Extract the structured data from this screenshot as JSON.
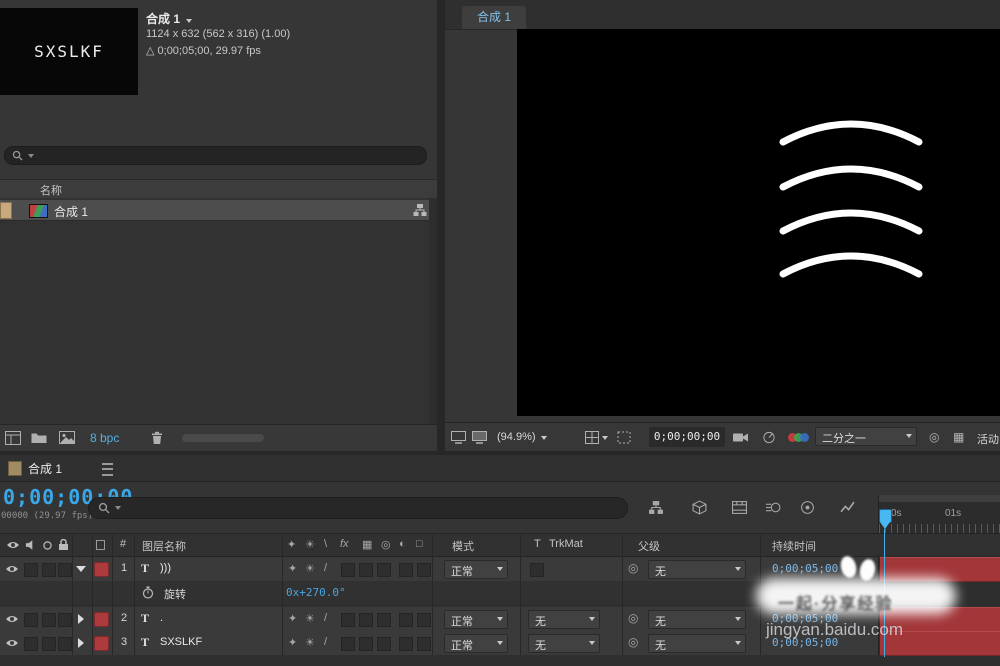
{
  "project": {
    "thumb_text": "SXSLKF",
    "comp_title": "合成 1",
    "info_size": "1124 x 632 (562 x 316) (1.00)",
    "info_duration": "△ 0;00;05;00, 29.97 fps",
    "name_column": "名称",
    "item_label": "合成 1",
    "bpc_label": "8 bpc"
  },
  "viewer": {
    "tab_label": "合成 1",
    "zoom_value": "(94.9%)",
    "timecode": "0;00;00;00",
    "resolution_value": "二分之一",
    "camera_label": "活动"
  },
  "timeline": {
    "tab_label": "合成 1",
    "timecode": "0;00;00;00",
    "frame_info": "00000 (29.97 fps)",
    "ruler_t0": "0s",
    "ruler_t1": "01s",
    "columns": {
      "num": "#",
      "name": "图层名称",
      "mode": "模式",
      "trkmat_t": "T",
      "trkmat": "TrkMat",
      "parent": "父级",
      "duration": "持续时间"
    },
    "switch_glyphs": {
      "shy": "✦",
      "sun": "☀",
      "bslash": "\\",
      "fx": "fx",
      "blur": "▦",
      "pick": "◎",
      "half": "◐",
      "cube": "□",
      "quality": "/"
    },
    "layers": [
      {
        "num": "1",
        "type_icon": "T",
        "name": ")))",
        "mode": "正常",
        "parent": "无",
        "duration": "0;00;05;00"
      },
      {
        "num": "2",
        "type_icon": "T",
        "name": ".",
        "mode": "正常",
        "trkmat": "无",
        "parent": "无",
        "duration": "0;00;05;00"
      },
      {
        "num": "3",
        "type_icon": "T",
        "name": "SXSLKF",
        "mode": "正常",
        "trkmat": "无",
        "parent": "无",
        "duration": "0;00;05;00"
      }
    ],
    "property": {
      "name": "旋转",
      "value": "0x+270.0°"
    }
  },
  "watermark": {
    "slogan": "一起·分享经验",
    "url": "jingyan.baidu.com"
  }
}
